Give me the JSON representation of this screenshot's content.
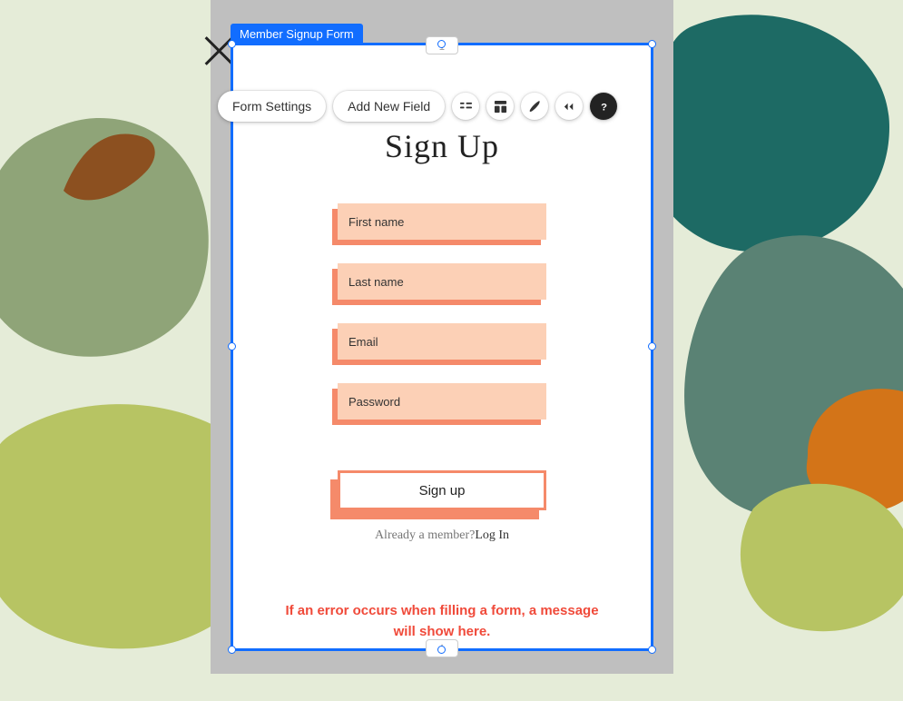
{
  "selection": {
    "label": "Member Signup Form"
  },
  "toolbar": {
    "settings_label": "Form Settings",
    "add_field_label": "Add New Field"
  },
  "form": {
    "title": "Sign Up",
    "fields": {
      "first_name": "First name",
      "last_name": "Last name",
      "email": "Email",
      "password": "Password"
    },
    "submit_label": "Sign up",
    "already_text": "Already a member?",
    "login_link": "Log In",
    "error_text": "If an error occurs when filling a form, a message will show here."
  },
  "collapse_glyph": "⤓"
}
